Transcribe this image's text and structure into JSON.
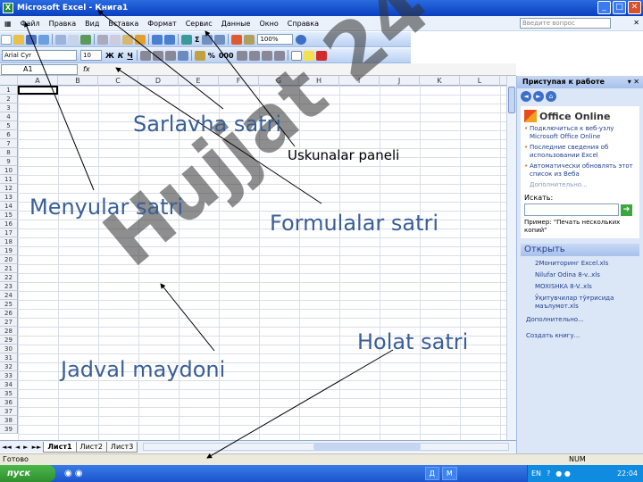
{
  "window": {
    "title": "Microsoft Excel - Книга1",
    "icon_label": "X",
    "buttons": {
      "minimize": "_",
      "maximize": "□",
      "close": "✕"
    }
  },
  "menubar": {
    "items": [
      "Файл",
      "Правка",
      "Вид",
      "Вставка",
      "Формат",
      "Сервис",
      "Данные",
      "Окно",
      "Справка"
    ],
    "help_placeholder": "Введите вопрос",
    "close_label": "✕"
  },
  "toolbar": {
    "zoom": "100%",
    "autosum": "Σ",
    "font_name": "Arial Cyr",
    "font_size": "10",
    "bold": "Ж",
    "italic": "К",
    "underline": "Ч",
    "percent": "%",
    "thousands": "000",
    "colors": {
      "fill": "#f4e04d",
      "font": "#d22b2b"
    }
  },
  "formula_bar": {
    "name_box": "A1",
    "fx": "fx"
  },
  "grid": {
    "columns": [
      "A",
      "B",
      "C",
      "D",
      "E",
      "F",
      "G",
      "H",
      "I",
      "J",
      "K",
      "L"
    ],
    "rows": [
      "1",
      "2",
      "3",
      "4",
      "5",
      "6",
      "7",
      "8",
      "9",
      "10",
      "11",
      "12",
      "13",
      "14",
      "15",
      "16",
      "17",
      "18",
      "19",
      "20",
      "21",
      "22",
      "23",
      "24",
      "25",
      "26",
      "27",
      "28",
      "29",
      "30",
      "31",
      "32",
      "33",
      "34",
      "35",
      "36",
      "37",
      "38",
      "39"
    ],
    "active_cell": "A1"
  },
  "sheets": {
    "nav": [
      "◄◄",
      "◄",
      "►",
      "►►"
    ],
    "tabs": [
      "Лист1",
      "Лист2",
      "Лист3"
    ],
    "active": "Лист1"
  },
  "status": {
    "left": "Готово",
    "num": "NUM"
  },
  "taskpane": {
    "title": "Приступая к работе",
    "nav": [
      "◄",
      "►",
      "⌂"
    ],
    "logo": "Office Online",
    "links": [
      "Подключиться к веб-узлу Microsoft Office Online",
      "Последние сведения об использовании Excel",
      "Автоматически обновлять этот список из Веба"
    ],
    "more": "Дополнительно...",
    "search_label": "Искать:",
    "search_go": "➔",
    "example": "Пример: \"Печать нескольких копий\"",
    "open_header": "Открыть",
    "files": [
      "2Мониторинг Excel.xls",
      "Nilufar Odina 8-v..xls",
      "MOXISHKA  8-V..xls",
      "Ўқитувчилар тўғрисида маълумот.xls"
    ],
    "open_more": "Дополнительно...",
    "create": "Создать книгу..."
  },
  "taskbar": {
    "start": "пуск",
    "items": [
      "Д",
      "M"
    ],
    "lang": "EN",
    "clock": "22:04"
  },
  "watermark": "Hujjat 24",
  "annotations": {
    "sarlavha": "Sarlavha satri",
    "uskunalar": "Uskunalar paneli",
    "menyular": "Menyular satri",
    "formulalar": "Formulalar satri",
    "holat": "Holat satri",
    "jadval": "Jadval maydoni"
  }
}
